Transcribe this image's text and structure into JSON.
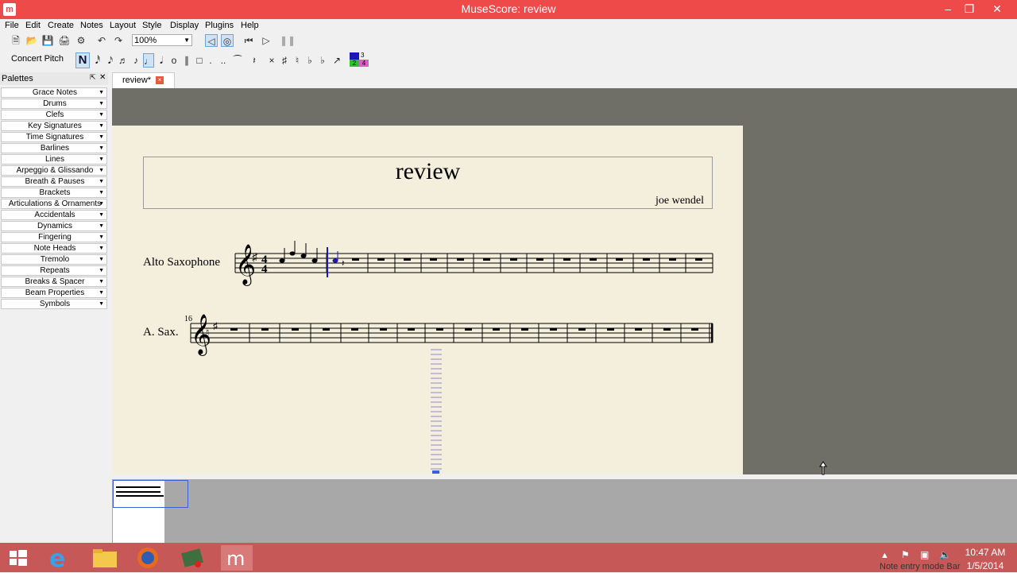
{
  "window": {
    "title": "MuseScore: review",
    "app_icon": "musescore-icon"
  },
  "menu": [
    "File",
    "Edit",
    "Create",
    "Notes",
    "Layout",
    "Style",
    "Display",
    "Plugins",
    "Help"
  ],
  "toolbar": {
    "zoom": "100%",
    "concert_pitch": "Concert Pitch",
    "note_input": "N"
  },
  "palettes": {
    "title": "Palettes",
    "items": [
      "Grace Notes",
      "Drums",
      "Clefs",
      "Key Signatures",
      "Time Signatures",
      "Barlines",
      "Lines",
      "Arpeggio & Glissando",
      "Breath & Pauses",
      "Brackets",
      "Articulations & Ornaments",
      "Accidentals",
      "Dynamics",
      "Fingering",
      "Note Heads",
      "Tremolo",
      "Repeats",
      "Breaks & Spacer",
      "Beam Properties",
      "Symbols"
    ]
  },
  "tab": {
    "label": "review*"
  },
  "score": {
    "title": "review",
    "composer": "joe wendel",
    "staff1_name": "Alto Saxophone",
    "staff2_name": "A. Sax.",
    "measure_number": "16",
    "time_sig_top": "4",
    "time_sig_bottom": "4"
  },
  "voice_colors": {
    "v1": "#1a1ab0",
    "v2": "#2cc02c",
    "v3": "#e05ad0",
    "accent": "#3a5fd9"
  },
  "voice_labels": {
    "top": "3",
    "bottom_left": "2",
    "bottom_right": "4"
  },
  "taskbar": {
    "time": "10:47 AM",
    "date": "1/5/2014"
  },
  "status": {
    "text": "Note entry mode Bar"
  }
}
